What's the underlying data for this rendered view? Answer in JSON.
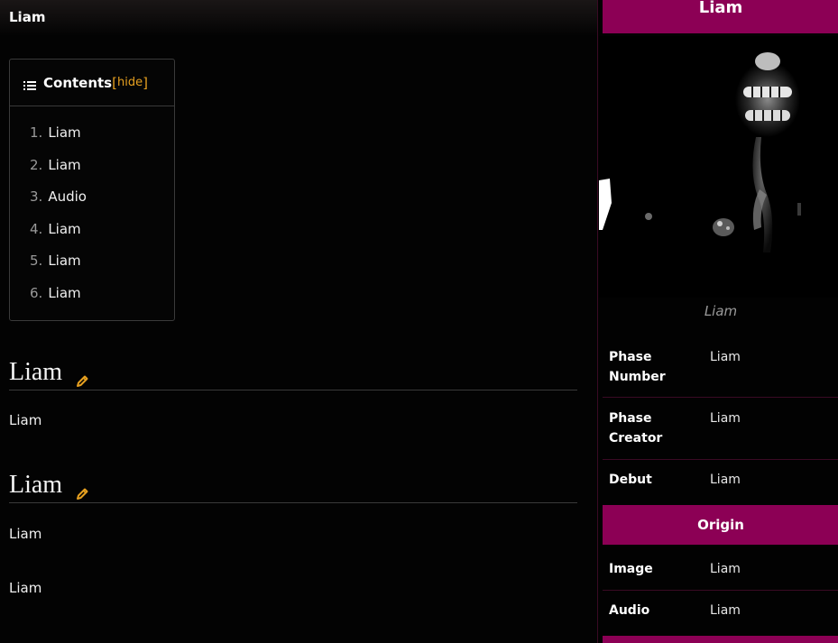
{
  "page": {
    "title": "Liam"
  },
  "toc": {
    "title": "Contents",
    "bracket_open": "[",
    "hide_label": "hide",
    "bracket_close": "]",
    "items": [
      {
        "num": "1.",
        "label": "Liam"
      },
      {
        "num": "2.",
        "label": "Liam"
      },
      {
        "num": "3.",
        "label": "Audio"
      },
      {
        "num": "4.",
        "label": "Liam"
      },
      {
        "num": "5.",
        "label": "Liam"
      },
      {
        "num": "6.",
        "label": "Liam"
      }
    ]
  },
  "sections": [
    {
      "heading": "Liam",
      "paragraphs": [
        "Liam"
      ]
    },
    {
      "heading": "Liam",
      "paragraphs": [
        "Liam",
        "Liam"
      ]
    }
  ],
  "infobox": {
    "title": "Liam",
    "caption": "Liam",
    "rows": [
      {
        "label": "Phase Number",
        "value": "Liam"
      },
      {
        "label": "Phase Creator",
        "value": "Liam"
      },
      {
        "label": "Debut",
        "value": "Liam"
      }
    ],
    "origin_header": "Origin",
    "origin_rows": [
      {
        "label": "Image",
        "value": "Liam"
      },
      {
        "label": "Audio",
        "value": "Liam"
      }
    ]
  },
  "colors": {
    "accent": "#8c0055",
    "link": "#e6a020",
    "background": "#030303"
  },
  "icons": {
    "toc": "list-icon",
    "edit": "pencil-icon"
  }
}
